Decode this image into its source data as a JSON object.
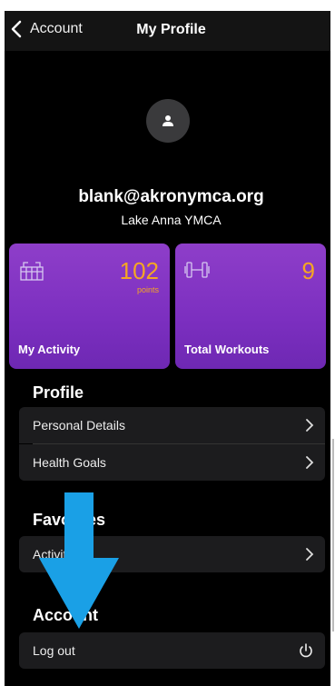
{
  "nav": {
    "back_label": "Account",
    "title": "My Profile"
  },
  "profile": {
    "email": "blank@akronymca.org",
    "location": "Lake Anna YMCA"
  },
  "cards": [
    {
      "value": "102",
      "unit": "points",
      "label": "My Activity",
      "icon": "gift-icon"
    },
    {
      "value": "9",
      "unit": "",
      "label": "Total Workouts",
      "icon": "dumbbell-icon"
    }
  ],
  "sections": {
    "profile": {
      "title": "Profile",
      "items": [
        "Personal Details",
        "Health Goals"
      ]
    },
    "favorites": {
      "title": "Favorites",
      "items": [
        "Activities"
      ]
    },
    "account": {
      "title": "Account",
      "items": [
        "Log out"
      ]
    }
  },
  "colors": {
    "accent_purple": "#7c2fc0",
    "value_orange": "#f5a623",
    "arrow_blue": "#1aa0e6"
  },
  "icons": [
    "chevron-left-icon",
    "user-icon",
    "gift-icon",
    "dumbbell-icon",
    "chevron-right-icon",
    "power-icon",
    "down-arrow-icon"
  ]
}
